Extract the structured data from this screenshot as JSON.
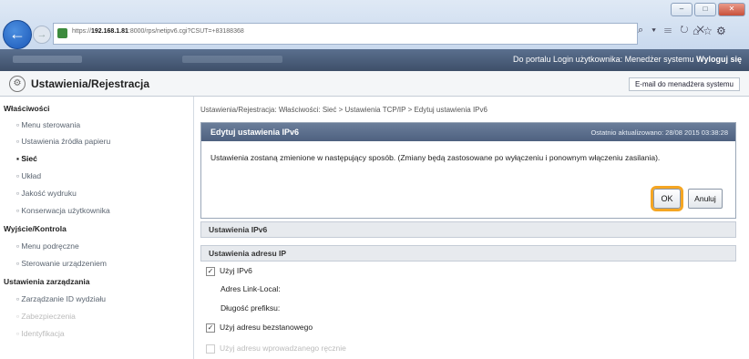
{
  "browser": {
    "url_prefix": "https://",
    "url_host": "192.168.1.81",
    "url_rest": ":8000/rps/netipv6.cgi?CSUT=+83188368",
    "address_tools": "⌕ ▾ ☰ ↻ ✕",
    "window_controls": [
      "–",
      "□",
      "✕"
    ]
  },
  "topbar": {
    "links": "Do portalu  Login użytkownika: Menedżer systemu",
    "logout": "Wyloguj się"
  },
  "header": {
    "title": "Ustawienia/Rejestracja",
    "email_link": "E-mail do menadżera systemu"
  },
  "sidebar": {
    "sections": [
      {
        "title": "Właściwości",
        "items": [
          {
            "label": "Menu sterowania",
            "state": "normal"
          },
          {
            "label": "Ustawienia źródła papieru",
            "state": "normal"
          },
          {
            "label": "Sieć",
            "state": "active"
          },
          {
            "label": "Układ",
            "state": "normal"
          },
          {
            "label": "Jakość wydruku",
            "state": "normal"
          },
          {
            "label": "Konserwacja użytkownika",
            "state": "normal"
          }
        ]
      },
      {
        "title": "Wyjście/Kontrola",
        "items": [
          {
            "label": "Menu podręczne",
            "state": "normal"
          },
          {
            "label": "Sterowanie urządzeniem",
            "state": "normal"
          }
        ]
      },
      {
        "title": "Ustawienia zarządzania",
        "items": [
          {
            "label": "Zarządzanie ID wydziału",
            "state": "normal"
          },
          {
            "label": "Zabezpieczenia",
            "state": "faded"
          },
          {
            "label": "Identyfikacja",
            "state": "faded"
          }
        ]
      }
    ]
  },
  "main": {
    "breadcrumb": "Ustawienia/Rejestracja: Właściwości: Sieć > Ustawienia TCP/IP > Edytuj ustawienia IPv6",
    "dialog": {
      "title": "Edytuj ustawienia IPv6",
      "updated": "Ostatnio aktualizowano: 28/08 2015 03:38:28",
      "message": "Ustawienia zostaną zmienione w następujący sposób. (Zmiany będą zastosowane po wyłączeniu i ponownym włączeniu zasilania).",
      "ok": "OK",
      "cancel": "Anuluj"
    },
    "section_ipv6": "Ustawienia IPv6",
    "section_ip": "Ustawienia adresu IP",
    "use_ipv6": "Użyj IPv6",
    "use_ipv6_checked": true,
    "link_local": "Adres Link-Local:",
    "prefix_length": "Długość prefiksu:",
    "use_stateless": "Użyj adresu bezstanowego",
    "use_stateless_checked": true,
    "use_manual": "Użyj adresu wprowadzanego ręcznie",
    "use_manual_checked": false
  }
}
